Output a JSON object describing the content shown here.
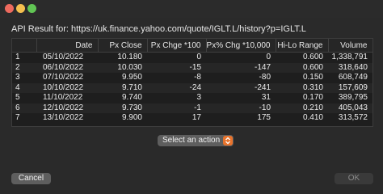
{
  "header": {
    "label": "API Result for: https://uk.finance.yahoo.com/quote/IGLT.L/history?p=IGLT.L"
  },
  "table": {
    "columns": [
      "",
      "Date",
      "Px Close",
      "Px Chge *100",
      "Px% Chg *10,000",
      "Hi-Lo Range",
      "Volume"
    ],
    "rows": [
      [
        "1",
        "05/10/2022",
        "10.180",
        "0",
        "0",
        "0.600",
        "1,338,791"
      ],
      [
        "2",
        "06/10/2022",
        "10.030",
        "-15",
        "-147",
        "0.600",
        "318,640"
      ],
      [
        "3",
        "07/10/2022",
        "9.950",
        "-8",
        "-80",
        "0.150",
        "608,749"
      ],
      [
        "4",
        "10/10/2022",
        "9.710",
        "-24",
        "-241",
        "0.310",
        "157,609"
      ],
      [
        "5",
        "11/10/2022",
        "9.740",
        "3",
        "31",
        "0.170",
        "389,795"
      ],
      [
        "6",
        "12/10/2022",
        "9.730",
        "-1",
        "-10",
        "0.210",
        "405,043"
      ],
      [
        "7",
        "13/10/2022",
        "9.900",
        "17",
        "175",
        "0.410",
        "313,572"
      ]
    ]
  },
  "action_select": {
    "label": "Select an action",
    "icon": "chevron-up-down-icon",
    "accent": "#e8732c"
  },
  "buttons": {
    "cancel_label": "Cancel",
    "ok_label": "OK"
  }
}
